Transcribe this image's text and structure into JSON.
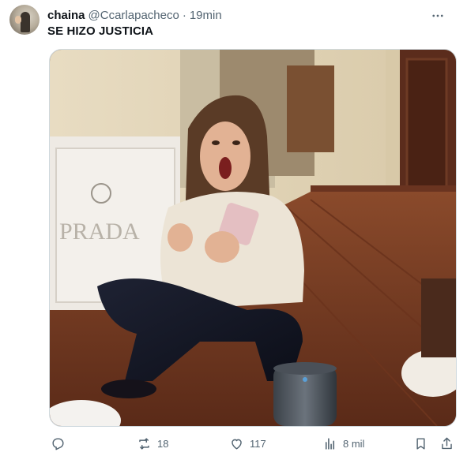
{
  "tweet": {
    "author_name": "chaina",
    "handle": "@Ccarlapacheco",
    "separator": "·",
    "time": "19min",
    "text": "SE HIZO JUSTICIA",
    "more_icon": "more-icon"
  },
  "media": {
    "bag_text": "PRADA"
  },
  "actions": {
    "replies": {
      "icon": "reply-icon",
      "count": ""
    },
    "retweets": {
      "icon": "retweet-icon",
      "count": "18"
    },
    "likes": {
      "icon": "heart-icon",
      "count": "117"
    },
    "views": {
      "icon": "views-icon",
      "count": "8 mil"
    },
    "bookmark": {
      "icon": "bookmark-icon"
    },
    "share": {
      "icon": "share-icon"
    }
  },
  "colors": {
    "text_primary": "#0f1419",
    "text_secondary": "#536471",
    "border": "#cfd9de"
  }
}
